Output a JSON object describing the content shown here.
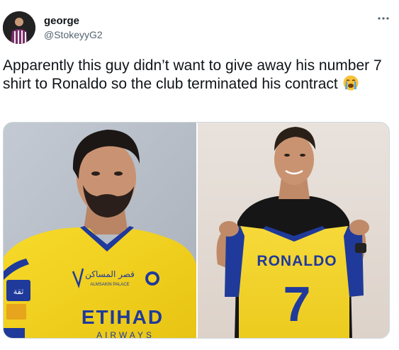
{
  "tweet": {
    "author_name": "george",
    "author_handle": "@StokeyyG2",
    "more_icon": "more-horizontal-icon",
    "text": "Apparently this guy didn’t want to give away his number 7 shirt to Ronaldo so the club terminated his contract",
    "emoji": "loudly-crying-face-emoji"
  },
  "media": {
    "left_photo": {
      "sponsor_main": "ETIHAD",
      "sponsor_sub": "AIRWAYS",
      "crest_text_ar": "قصر المساكن",
      "crest_text_en": "ALMSAKIN PALACE",
      "badge_text_ar": "ثقة"
    },
    "right_photo": {
      "shirt_name": "RONALDO",
      "shirt_number": "7"
    }
  },
  "colors": {
    "kit_yellow": "#f5d21c",
    "kit_blue": "#1f3a9a",
    "text_primary": "#0f1419",
    "text_secondary": "#536471"
  }
}
